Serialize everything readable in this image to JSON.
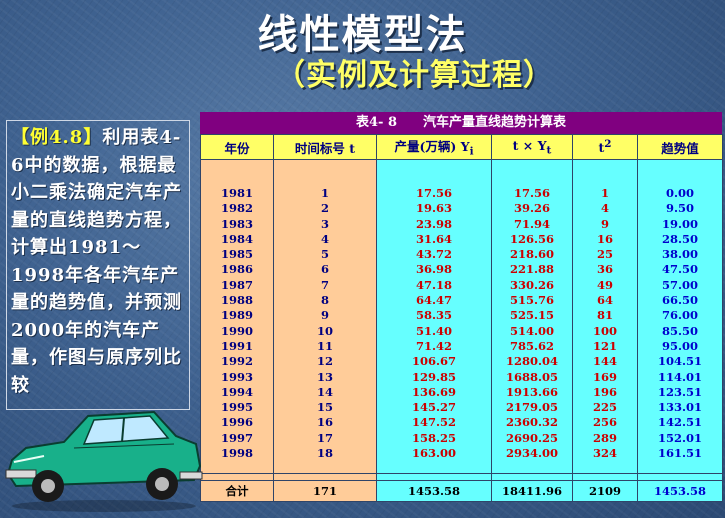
{
  "slide": {
    "title": "线性模型法",
    "subtitle": "（实例及计算过程）"
  },
  "example": {
    "label": "【例4.8】",
    "text": "利用表4-6中的数据，根据最小二乘法确定汽车产量的直线趋势方程，计算出1981～1998年各年汽车产量的趋势值，并预测2000年的汽车产量，作图与原序列比较"
  },
  "table": {
    "caption": "表4- 8　　汽车产量直线趋势计算表",
    "headers": {
      "year": "年份",
      "t": "时间标号 t",
      "y_main": "产量(万辆) Y",
      "y_sub": "i",
      "ty_main": "t × Y",
      "ty_sub": "t",
      "t2_main": "t",
      "t2_sup": "2",
      "trend": "趋势值"
    },
    "years": [
      "1981",
      "1982",
      "1983",
      "1984",
      "1985",
      "1986",
      "1987",
      "1988",
      "1989",
      "1990",
      "1991",
      "1992",
      "1993",
      "1994",
      "1995",
      "1996",
      "1997",
      "1998"
    ],
    "t": [
      "1",
      "2",
      "3",
      "4",
      "5",
      "6",
      "7",
      "8",
      "9",
      "10",
      "11",
      "12",
      "13",
      "14",
      "15",
      "16",
      "17",
      "18"
    ],
    "y": [
      "17.56",
      "19.63",
      "23.98",
      "31.64",
      "43.72",
      "36.98",
      "47.18",
      "64.47",
      "58.35",
      "51.40",
      "71.42",
      "106.67",
      "129.85",
      "136.69",
      "145.27",
      "147.52",
      "158.25",
      "163.00"
    ],
    "ty": [
      "17.56",
      "39.26",
      "71.94",
      "126.56",
      "218.60",
      "221.88",
      "330.26",
      "515.76",
      "525.15",
      "514.00",
      "785.62",
      "1280.04",
      "1688.05",
      "1913.66",
      "2179.05",
      "2360.32",
      "2690.25",
      "2934.00"
    ],
    "t2": [
      "1",
      "4",
      "9",
      "16",
      "25",
      "36",
      "49",
      "64",
      "81",
      "100",
      "121",
      "144",
      "169",
      "196",
      "225",
      "256",
      "289",
      "324"
    ],
    "trend": [
      "0.00",
      "9.50",
      "19.00",
      "28.50",
      "38.00",
      "47.50",
      "57.00",
      "66.50",
      "76.00",
      "85.50",
      "95.00",
      "104.51",
      "114.01",
      "123.51",
      "133.01",
      "142.51",
      "152.01",
      "161.51"
    ],
    "totals": {
      "label": "合计",
      "t": "171",
      "y": "1453.58",
      "ty": "18411.96",
      "t2": "2109",
      "trend": "1453.58"
    }
  },
  "colors": {
    "caption_bg": "#800080",
    "header_bg": "#ffff66",
    "left_cols_bg": "#ffcc99",
    "right_cols_bg": "#66ffff",
    "value_red": "#cc0000",
    "value_blue": "#0000cc"
  },
  "icons": [
    "car-illustration"
  ]
}
